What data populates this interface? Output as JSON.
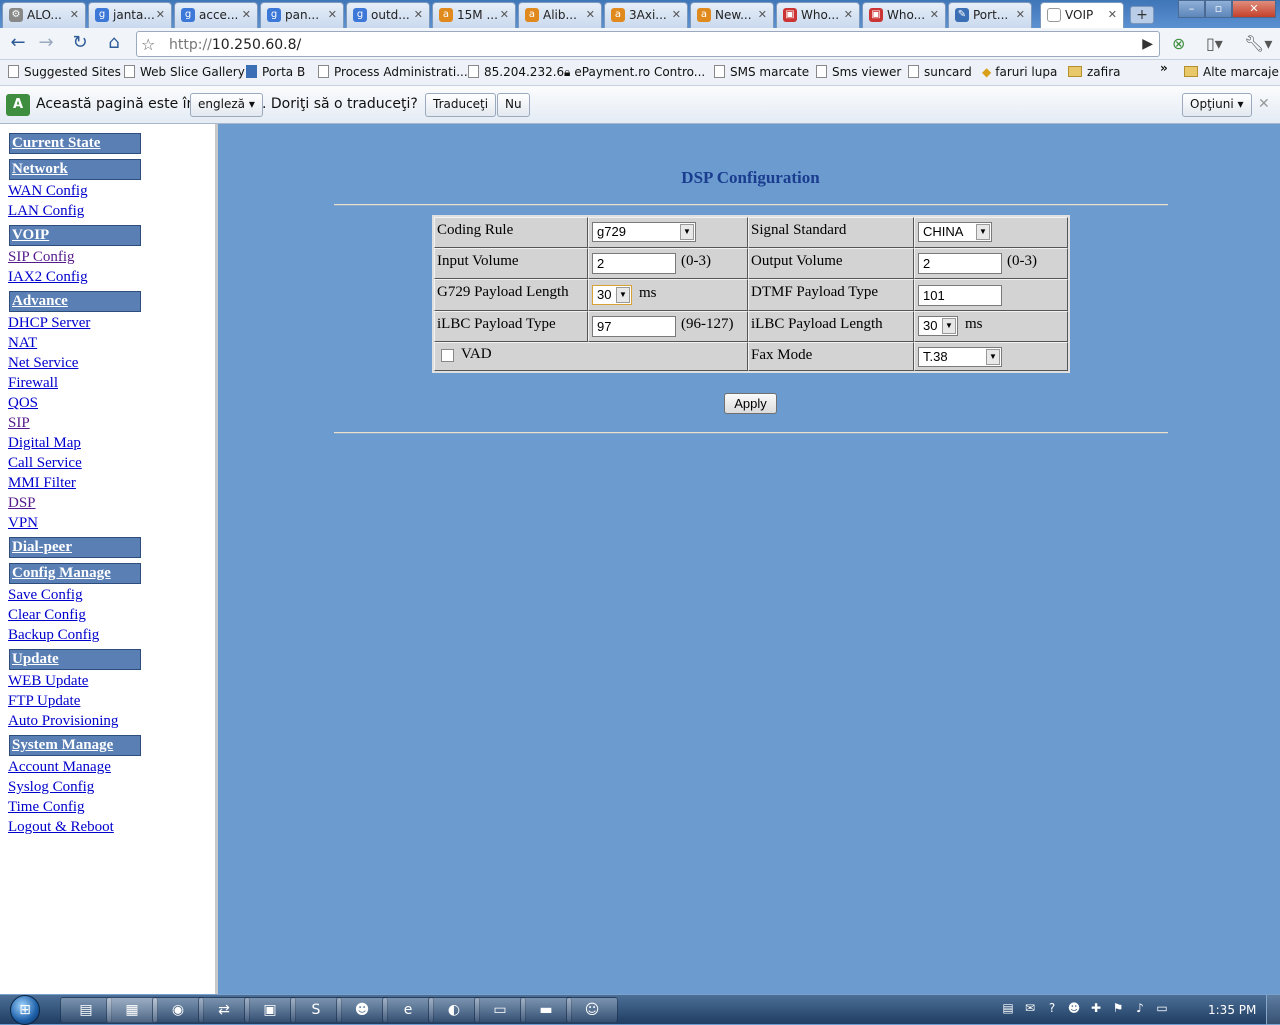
{
  "browser": {
    "tabs": [
      {
        "label": "ALO...",
        "icon": "gear-icon"
      },
      {
        "label": "janta...",
        "icon": "google-icon"
      },
      {
        "label": "acce...",
        "icon": "google-icon"
      },
      {
        "label": "pan...",
        "icon": "google-icon"
      },
      {
        "label": "outd...",
        "icon": "google-icon"
      },
      {
        "label": "15M ...",
        "icon": "alibaba-icon"
      },
      {
        "label": "Alib...",
        "icon": "alibaba-icon"
      },
      {
        "label": "3Axi...",
        "icon": "alibaba-icon"
      },
      {
        "label": "New...",
        "icon": "alibaba-icon"
      },
      {
        "label": "Who...",
        "icon": "cart-icon"
      },
      {
        "label": "Who...",
        "icon": "cart-icon"
      },
      {
        "label": "Port...",
        "icon": "edit-icon"
      },
      {
        "label": "VOIP",
        "icon": "page-icon"
      }
    ],
    "new_tab": "+",
    "window_controls": {
      "minimize": "–",
      "maximize": "▫",
      "close": "✕"
    },
    "url": "http://10.250.60.8/",
    "url_prefix": "http://",
    "url_host": "10.250.60.8/",
    "bookmarks": [
      {
        "label": "Suggested Sites",
        "icon": "page-icon"
      },
      {
        "label": "Web Slice Gallery",
        "icon": "page-icon"
      },
      {
        "label": "Porta B",
        "icon": "porta-icon"
      },
      {
        "label": "Process Administrati...",
        "icon": "page-icon"
      },
      {
        "label": "85.204.232.6",
        "icon": "page-icon"
      },
      {
        "label": "ePayment.ro Contro...",
        "icon": "lock-icon"
      },
      {
        "label": "SMS marcate",
        "icon": "page-icon"
      },
      {
        "label": "Sms viewer",
        "icon": "page-icon"
      },
      {
        "label": "suncard",
        "icon": "page-icon"
      },
      {
        "label": "faruri lupa",
        "icon": "alibaba-icon"
      },
      {
        "label": "zafira",
        "icon": "folder-icon"
      }
    ],
    "bookmarks_more": "»",
    "other_bookmarks": "Alte marcaje",
    "translate_bar": {
      "text_before": "Această pagină este în",
      "language": "engleză",
      "text_after": ". Doriţi să o traduceţi?",
      "translate_button": "Traduceţi",
      "no_button": "Nu",
      "options_button": "Opţiuni",
      "close": "✕"
    }
  },
  "sidebar": {
    "sections": [
      {
        "header": "Current State",
        "links": []
      },
      {
        "header": "Network",
        "links": [
          "WAN Config",
          "LAN Config"
        ]
      },
      {
        "header": "VOIP",
        "links": [
          "SIP Config",
          "IAX2 Config"
        ]
      },
      {
        "header": "Advance",
        "links": [
          "DHCP Server",
          "NAT",
          "Net Service",
          "Firewall",
          "QOS",
          "SIP",
          "Digital Map",
          "Call Service",
          "MMI Filter",
          "DSP",
          "VPN"
        ]
      },
      {
        "header": "Dial-peer",
        "links": []
      },
      {
        "header": "Config Manage",
        "links": [
          "Save Config",
          "Clear Config",
          "Backup Config"
        ]
      },
      {
        "header": "Update",
        "links": [
          "WEB Update",
          "FTP Update",
          "Auto Provisioning"
        ]
      },
      {
        "header": "System Manage",
        "links": [
          "Account Manage",
          "Syslog Config",
          "Time Config",
          "Logout & Reboot"
        ]
      }
    ]
  },
  "page": {
    "title": "DSP Configuration",
    "fields": {
      "coding_rule": {
        "label": "Coding Rule",
        "value": "g729"
      },
      "signal_standard": {
        "label": "Signal Standard",
        "value": "CHINA"
      },
      "input_volume": {
        "label": "Input Volume",
        "value": "2",
        "range": "(0-3)"
      },
      "output_volume": {
        "label": "Output Volume",
        "value": "2",
        "range": "(0-3)"
      },
      "g729_payload_length": {
        "label": "G729 Payload Length",
        "value": "30",
        "unit": "ms"
      },
      "dtmf_payload_type": {
        "label": "DTMF Payload Type",
        "value": "101"
      },
      "ilbc_payload_type": {
        "label": "iLBC Payload Type",
        "value": "97",
        "range": "(96-127)"
      },
      "ilbc_payload_length": {
        "label": "iLBC Payload Length",
        "value": "30",
        "unit": "ms"
      },
      "vad": {
        "label": "VAD",
        "checked": false
      },
      "fax_mode": {
        "label": "Fax Mode",
        "value": "T.38"
      }
    },
    "apply_button": "Apply"
  },
  "taskbar": {
    "start": "⊞",
    "apps": [
      "explorer-icon",
      "media-icon",
      "chrome-icon",
      "network-icon",
      "monitor-icon",
      "skype-icon",
      "messenger-icon",
      "ie-icon",
      "app-icon",
      "notepad-icon",
      "cmd-icon",
      "smiley-icon"
    ],
    "clock": "1:35 PM"
  },
  "colors": {
    "content_bg": "#6b9bcf",
    "sidebar_header": "#5a7fb4",
    "title": "#1a3d8f",
    "link": "#0000cc"
  }
}
